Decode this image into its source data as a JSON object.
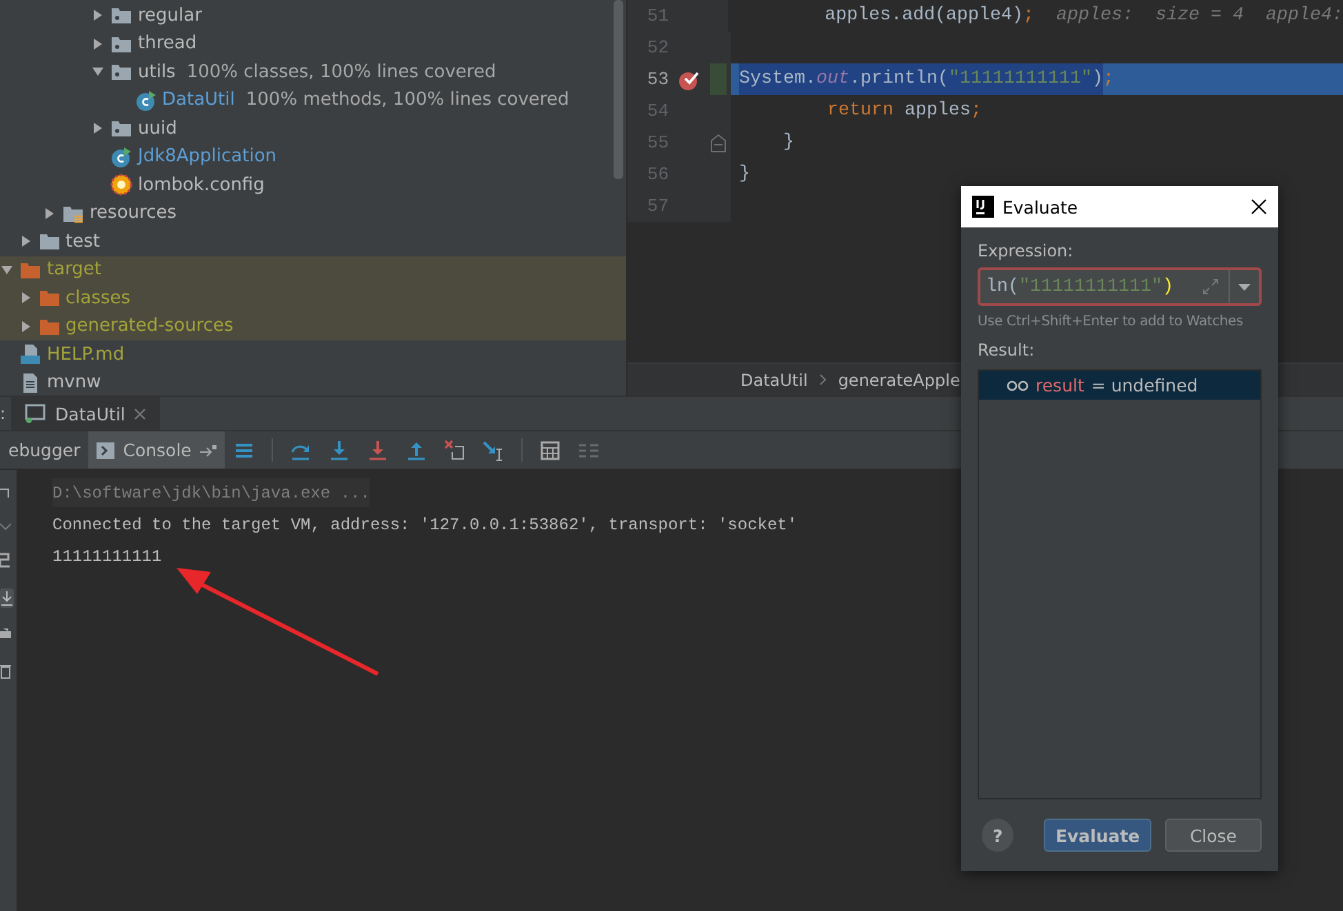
{
  "project_tree": [
    {
      "children": [
        {
          "children": [
            {
              "children": [
                {
                  "children": [
                    {
                      "label": "regular",
                      "kind": "package",
                      "expanded": false,
                      "excluded": false,
                      "ignored": false
                    },
                    {
                      "label": "thread",
                      "kind": "package",
                      "expanded": false,
                      "excluded": false,
                      "ignored": false
                    },
                    {
                      "label": "utils",
                      "kind": "package",
                      "expanded": true,
                      "excluded": false,
                      "ignored": false,
                      "note": "100% classes, 100% lines covered",
                      "children": [
                        {
                          "label": "DataUtil",
                          "kind": "class",
                          "excluded": false,
                          "ignored": false,
                          "note": "100% methods, 100% lines covered"
                        }
                      ]
                    },
                    {
                      "label": "uuid",
                      "kind": "package",
                      "expanded": false,
                      "excluded": false,
                      "ignored": false
                    },
                    {
                      "label": "Jdk8Application",
                      "kind": "class",
                      "excluded": false,
                      "ignored": false
                    },
                    {
                      "label": "lombok.config",
                      "kind": "config",
                      "excluded": false,
                      "ignored": false
                    }
                  ]
                }
              ]
            },
            {
              "label": "resources",
              "kind": "resources",
              "expanded": false,
              "excluded": false,
              "ignored": false
            }
          ]
        },
        {
          "label": "test",
          "kind": "folder",
          "expanded": false,
          "excluded": false,
          "ignored": false
        }
      ]
    },
    {
      "label": "target",
      "kind": "folder",
      "expanded": true,
      "excluded": true,
      "ignored": false,
      "children": [
        {
          "label": "classes",
          "kind": "folder",
          "expanded": false,
          "excluded": true,
          "ignored": false
        },
        {
          "label": "generated-sources",
          "kind": "folder",
          "expanded": false,
          "excluded": true,
          "ignored": false
        }
      ]
    },
    {
      "label": "HELP.md",
      "kind": "markdown",
      "excluded": false,
      "ignored": true
    },
    {
      "label": "mvnw",
      "kind": "file",
      "excluded": false,
      "ignored": false
    }
  ],
  "editor": {
    "lines": [
      {
        "number": "51",
        "current": false,
        "breakpoint": false,
        "fold": false,
        "segments": [
          {
            "text": "        apples.add(apple4)",
            "kind": "plain",
            "selected": false
          },
          {
            "text": ";",
            "kind": "punct",
            "selected": false
          },
          {
            "text": "  apples:  size = 4  apple4:",
            "kind": "hint",
            "selected": false
          }
        ]
      },
      {
        "number": "52",
        "current": false,
        "breakpoint": false,
        "fold": false
      },
      {
        "number": "53",
        "current": true,
        "breakpoint": true,
        "fold": false,
        "segments": [
          {
            "text": "        System.",
            "kind": "plain",
            "selected": true
          },
          {
            "text": "out",
            "kind": "static",
            "selected": true
          },
          {
            "text": ".println(",
            "kind": "plain",
            "selected": true
          },
          {
            "text": "\"11111111111\"",
            "kind": "string",
            "selected": true
          },
          {
            "text": ")",
            "kind": "plain",
            "selected": true
          },
          {
            "text": ";",
            "kind": "punct",
            "selected": false
          }
        ]
      },
      {
        "number": "54",
        "current": false,
        "breakpoint": false,
        "fold": false,
        "segments": [
          {
            "text": "        return",
            "kind": "keyword",
            "selected": false
          },
          {
            "text": " apples",
            "kind": "plain",
            "selected": false
          },
          {
            "text": ";",
            "kind": "punct",
            "selected": false
          }
        ]
      },
      {
        "number": "55",
        "current": false,
        "breakpoint": false,
        "fold": true,
        "segments": [
          {
            "text": "    }",
            "kind": "plain",
            "selected": false
          }
        ]
      },
      {
        "number": "56",
        "current": false,
        "breakpoint": false,
        "fold": false,
        "segments": [
          {
            "text": "}",
            "kind": "plain",
            "selected": false
          }
        ]
      },
      {
        "number": "57",
        "current": false,
        "breakpoint": false,
        "fold": false
      }
    ],
    "breadcrumbs": [
      "DataUtil",
      "generateApple"
    ]
  },
  "debug_panel": {
    "label": ":",
    "run_tabs": [
      {
        "label": "DataUtil",
        "selected": true
      }
    ],
    "tabs": [
      {
        "label": "ebugger",
        "selected": false
      },
      {
        "label": "Console",
        "selected": true
      }
    ],
    "console": [
      {
        "text": "D:\\software\\jdk\\bin\\java.exe ...",
        "kind": "command"
      },
      {
        "text": "Connected to the target VM, address: '127.0.0.1:53862', transport: 'socket'",
        "kind": "output"
      },
      {
        "text": "11111111111",
        "kind": "output"
      }
    ]
  },
  "evaluate_dialog": {
    "title": "Evaluate",
    "expression_label": "Expression:",
    "expression": [
      {
        "text": "ln(",
        "kind": "plain"
      },
      {
        "text": "\"11111111111\"",
        "kind": "string"
      },
      {
        "text": ")",
        "kind": "paren"
      }
    ],
    "expression_error": true,
    "hint": "Use Ctrl+Shift+Enter to add to Watches",
    "result_label": "Result:",
    "result": {
      "name": "result",
      "value": "= undefined",
      "selected": true
    },
    "buttons": [
      {
        "label": "?",
        "kind": "help"
      },
      {
        "label": "Evaluate",
        "kind": "default"
      },
      {
        "label": "Close",
        "kind": "normal"
      }
    ]
  }
}
